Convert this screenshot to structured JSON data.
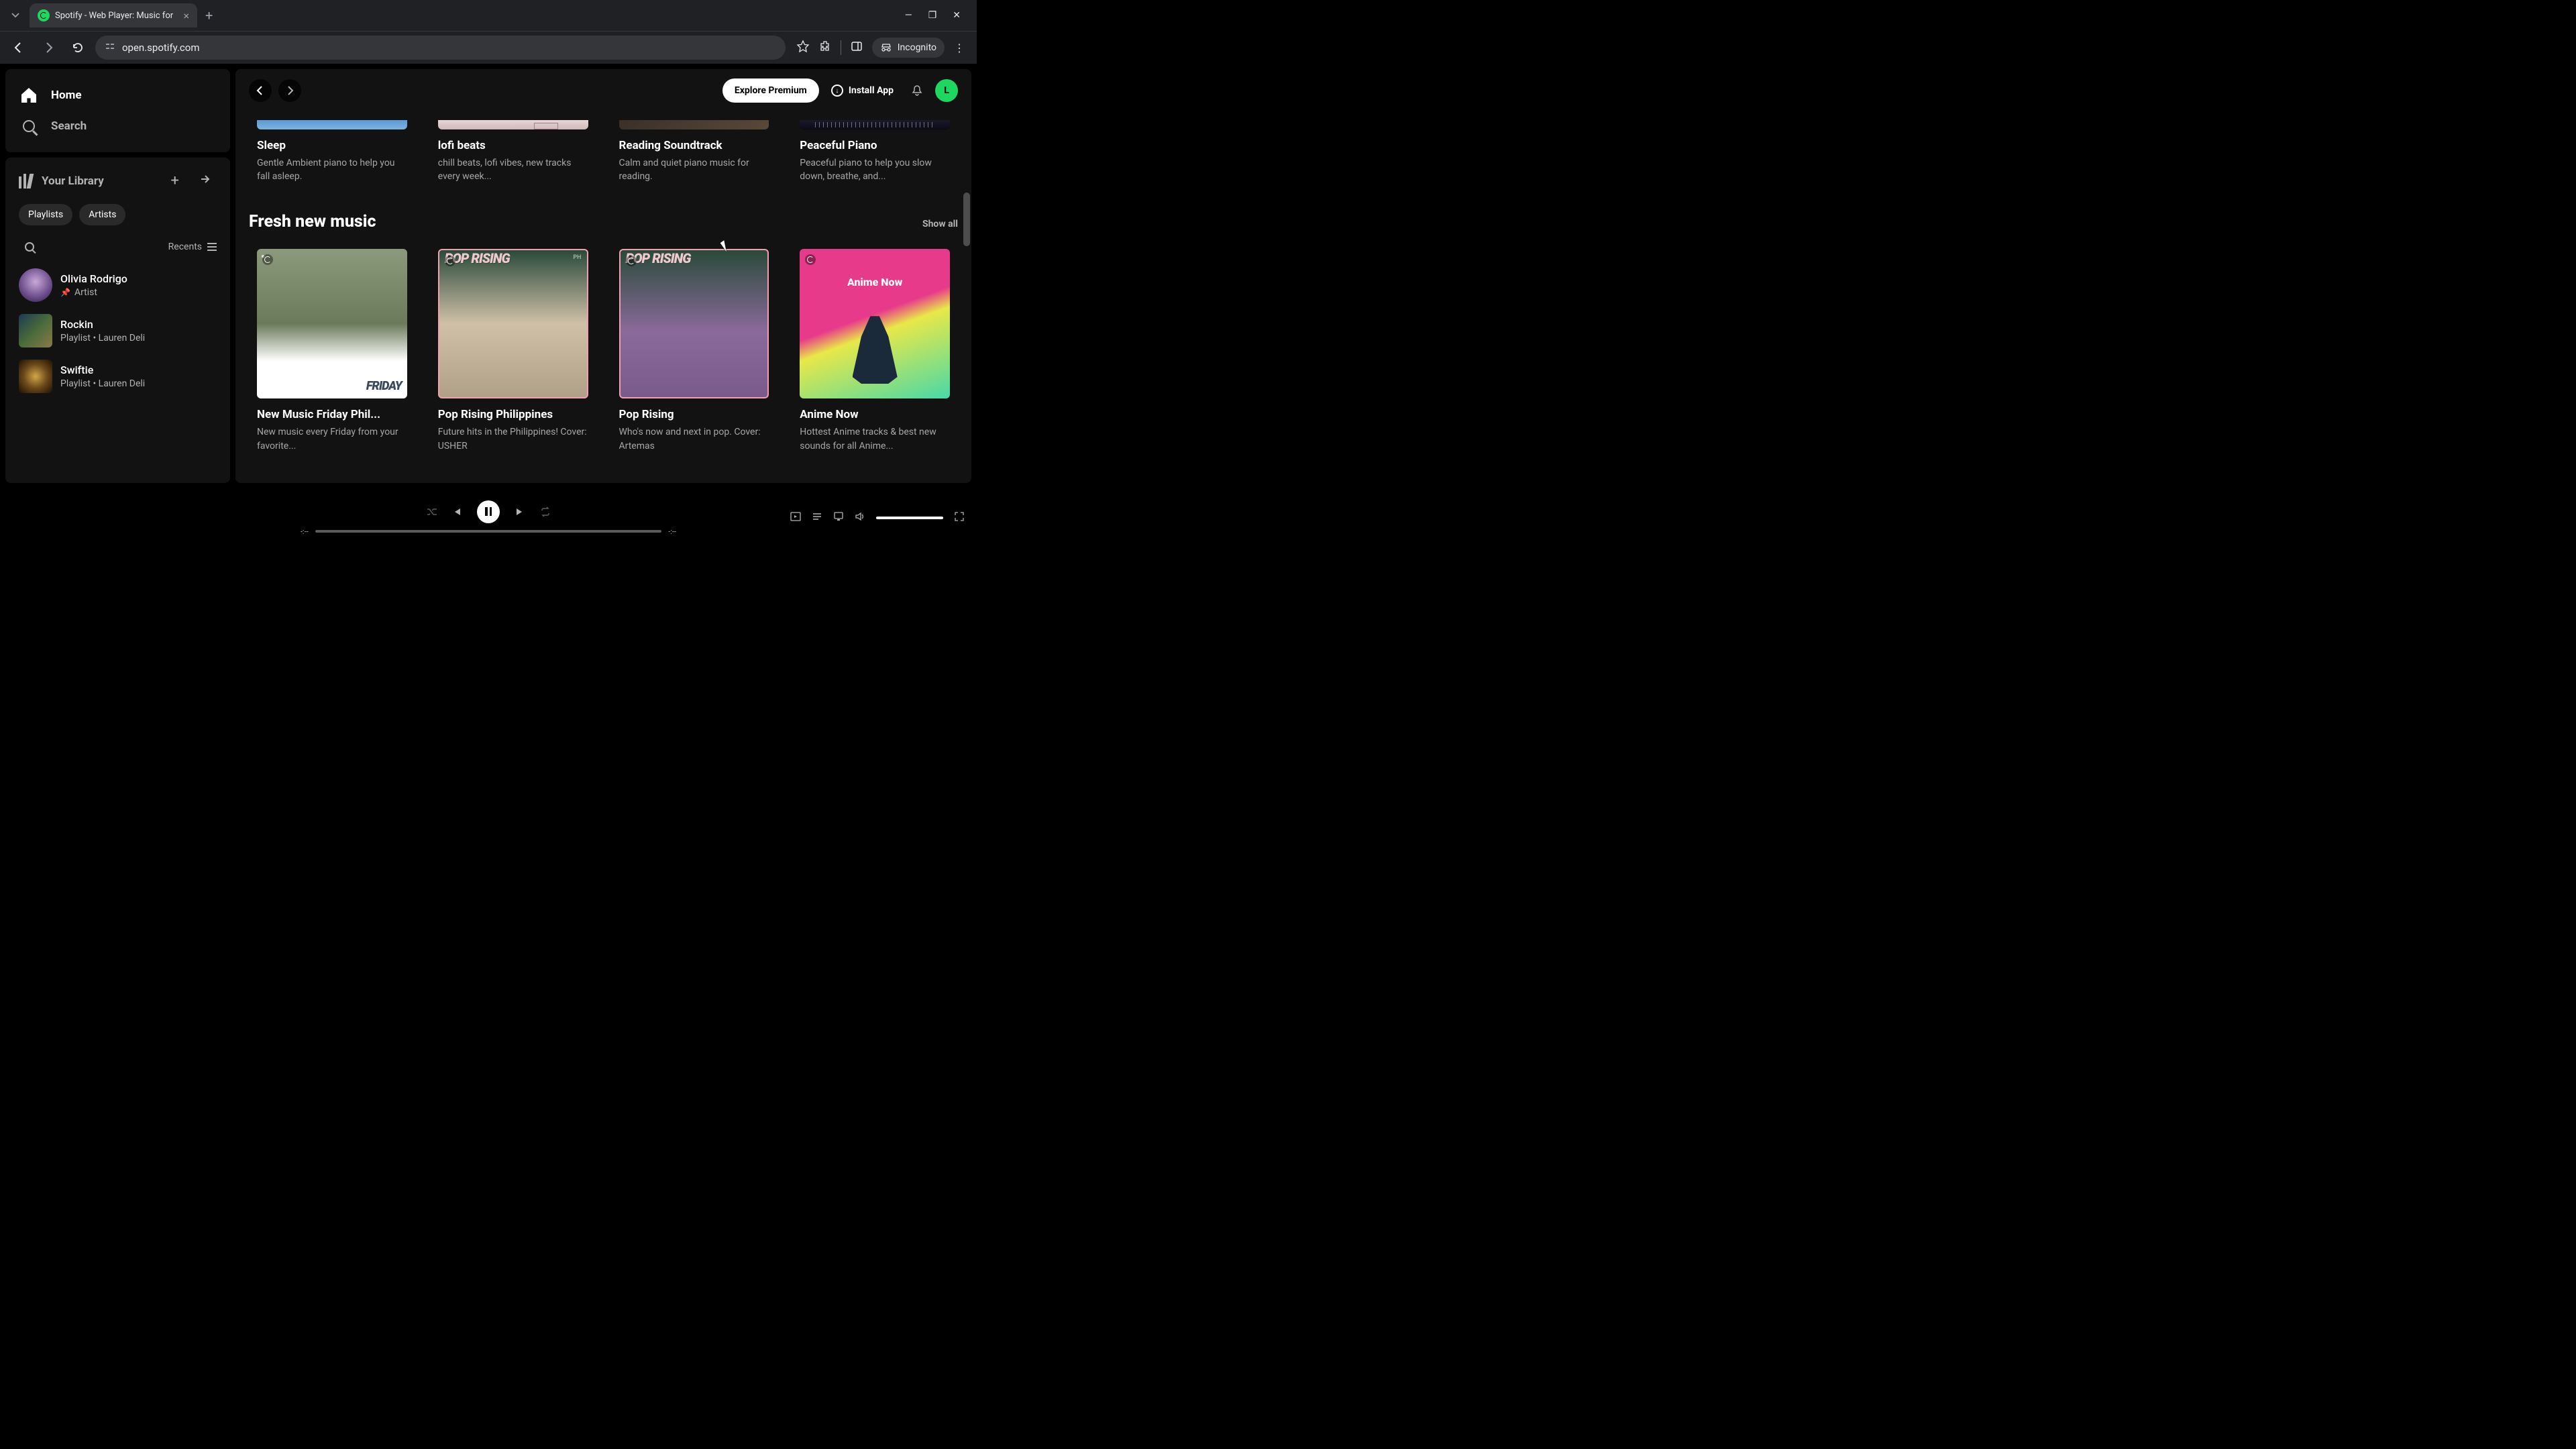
{
  "browser": {
    "tab_title": "Spotify - Web Player: Music for",
    "url": "open.spotify.com",
    "incognito_label": "Incognito"
  },
  "sidebar": {
    "home": "Home",
    "search": "Search",
    "library": "Your Library",
    "chips": [
      "Playlists",
      "Artists"
    ],
    "recents": "Recents",
    "items": [
      {
        "name": "Olivia Rodrigo",
        "sub": "Artist",
        "pinned": true
      },
      {
        "name": "Rockin",
        "sub": "Playlist • Lauren Deli",
        "pinned": false
      },
      {
        "name": "Swiftie",
        "sub": "Playlist • Lauren Deli",
        "pinned": false
      }
    ]
  },
  "header": {
    "explore": "Explore Premium",
    "install": "Install App",
    "avatar": "L"
  },
  "section_partial": {
    "cards": [
      {
        "title": "Sleep",
        "desc": "Gentle Ambient piano to help you fall asleep."
      },
      {
        "title": "lofi beats",
        "desc": "chill beats, lofi vibes, new tracks every week..."
      },
      {
        "title": "Reading Soundtrack",
        "desc": "Calm and quiet piano music for reading."
      },
      {
        "title": "Peaceful Piano",
        "desc": "Peaceful piano to help you slow down, breathe, and..."
      }
    ]
  },
  "section_fresh": {
    "title": "Fresh new music",
    "show_all": "Show all",
    "cards": [
      {
        "title": "New Music Friday Phil...",
        "desc": "New music every Friday from your favorite..."
      },
      {
        "title": "Pop Rising Philippines",
        "desc": "Future hits in the Philippines! Cover: USHER"
      },
      {
        "title": "Pop Rising",
        "desc": "Who's now and next in pop. Cover: Artemas"
      },
      {
        "title": "Anime Now",
        "desc": "Hottest Anime tracks & best new sounds for all Anime..."
      }
    ]
  },
  "player": {
    "elapsed": "-:--",
    "total": "-:--"
  }
}
